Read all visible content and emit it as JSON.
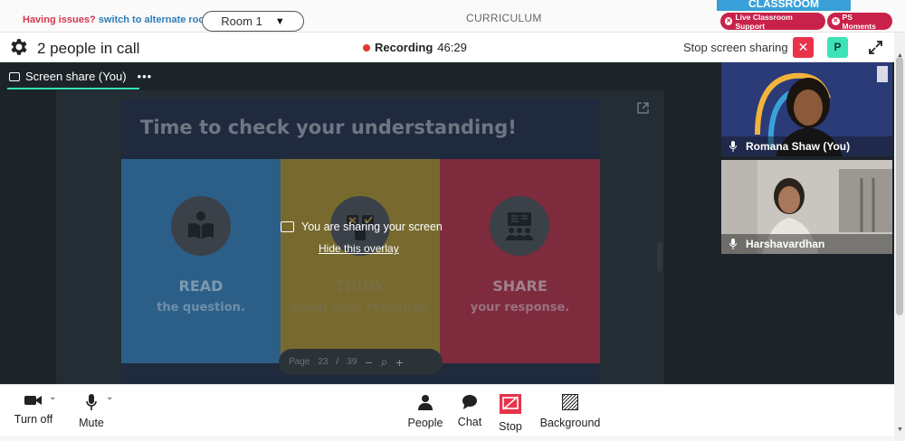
{
  "topbar": {
    "issues_text": "Having issues?",
    "alt_room_link": "switch to alternate room",
    "room_select": "Room 1",
    "curriculum_label": "CURRICULUM",
    "brand_text": "CLASSROOM",
    "live_support": "Live Classroom Support",
    "ps_moments": "PS Moments"
  },
  "call_header": {
    "people_count": "2 people in call",
    "recording_label": "Recording",
    "recording_time": "46:29",
    "stop_share_label": "Stop screen sharing",
    "presenter_initial": "P"
  },
  "stage": {
    "tab_label": "Screen share (You)",
    "tab_more": "•••",
    "overlay_message": "You are sharing your screen",
    "overlay_hide": "Hide this overlay"
  },
  "slide": {
    "title": "Time to check your understanding!",
    "columns": [
      {
        "heading": "READ",
        "sub": "the question.",
        "icon": "reading-book-icon",
        "color": "#2c5f88"
      },
      {
        "heading": "THINK",
        "sub": "about your response.",
        "icon": "thinking-icon",
        "color": "#786a2e"
      },
      {
        "heading": "SHARE",
        "sub": "your response.",
        "icon": "presentation-group-icon",
        "color": "#7d2b3d"
      }
    ],
    "pager": {
      "label": "Page",
      "current": "23",
      "separator": "/",
      "total": "39"
    }
  },
  "participants": [
    {
      "name": "Romana Shaw (You)"
    },
    {
      "name": "Harshavardhan"
    }
  ],
  "toolbar": {
    "camera_label": "Turn off",
    "mic_label": "Mute",
    "people_label": "People",
    "chat_label": "Chat",
    "stop_label": "Stop",
    "background_label": "Background"
  },
  "colors": {
    "accent_green": "#32e0b3",
    "danger_red": "#e8334a",
    "support_pink": "#c9224a",
    "link_blue": "#2f7db7"
  }
}
